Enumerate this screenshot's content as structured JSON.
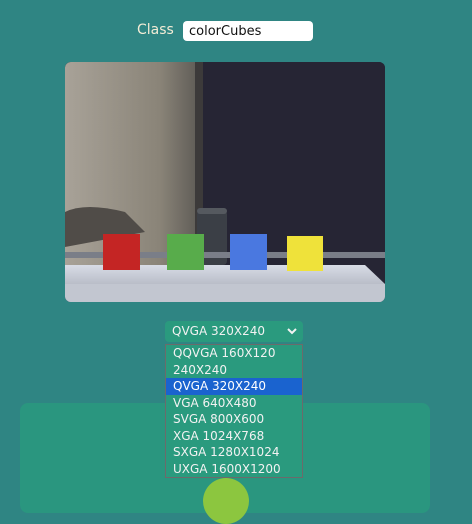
{
  "class_field": {
    "label": "Class",
    "value": "colorCubes"
  },
  "camera": {
    "cube_colors": [
      "#c42524",
      "#58ac4b",
      "#4a78e0",
      "#efe23a"
    ]
  },
  "resolution": {
    "selected": "QVGA 320X240",
    "options": [
      "QQVGA 160X120",
      "240X240",
      "QVGA 320X240",
      "VGA 640X480",
      "SVGA 800X600",
      "XGA 1024X768",
      "SXGA 1280X1024",
      "UXGA 1600X1200"
    ]
  },
  "colors": {
    "background": "#2f8583",
    "panel": "#2a967f",
    "highlight": "#1a63cf",
    "capture_button": "#8cc63f"
  }
}
